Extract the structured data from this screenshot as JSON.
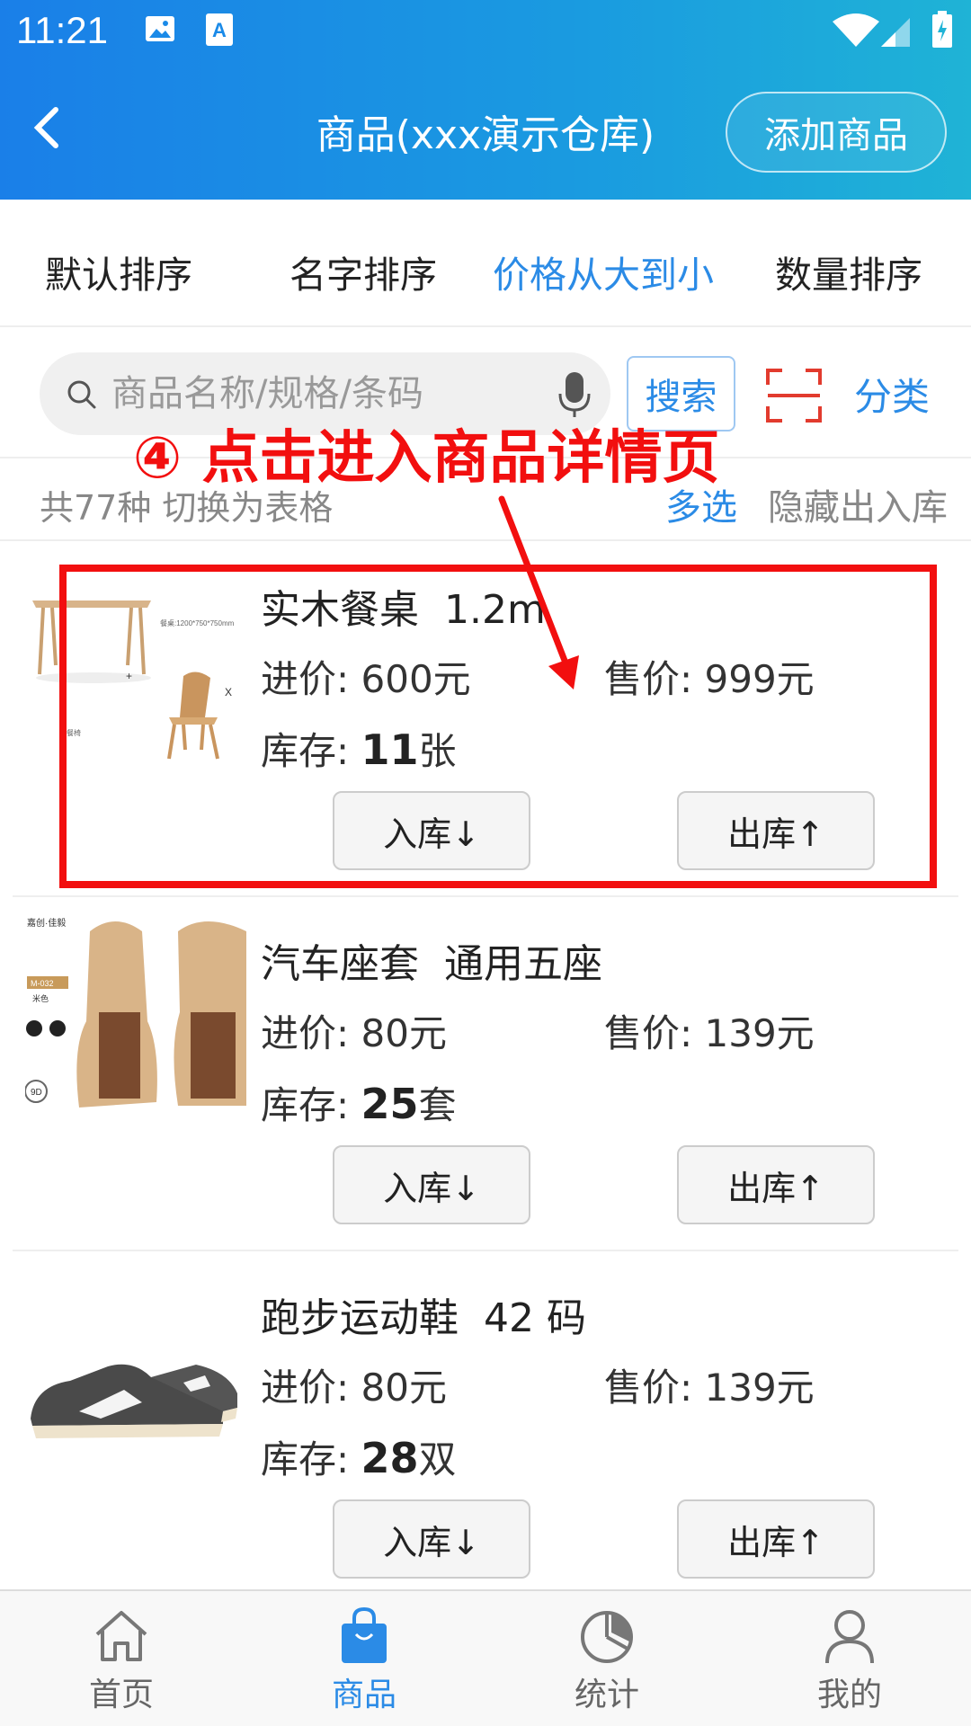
{
  "status": {
    "time": "11:21"
  },
  "header": {
    "title": "商品(xxx演示仓库)",
    "add_label": "添加商品"
  },
  "sort_tabs": [
    {
      "label": "默认排序"
    },
    {
      "label": "名字排序"
    },
    {
      "label": "价格从大到小",
      "active": true
    },
    {
      "label": "数量排序"
    }
  ],
  "search": {
    "placeholder": "商品名称/规格/条码",
    "button_label": "搜索",
    "category_label": "分类"
  },
  "info": {
    "count_text": "共77种  切换为表格",
    "multi_select": "多选",
    "hide_label": "隐藏出入库"
  },
  "annotation": {
    "text": "④ 点击进入商品详情页"
  },
  "products": [
    {
      "name": "实木餐桌  1.2m",
      "cost_label": "进价:",
      "cost": "600元",
      "price_label": "售价:",
      "price": "999元",
      "stock_label": "库存:",
      "stock": "11",
      "unit": "张",
      "in_label": "入库↓",
      "out_label": "出库↑"
    },
    {
      "name": "汽车座套  通用五座",
      "cost_label": "进价:",
      "cost": "80元",
      "price_label": "售价:",
      "price": "139元",
      "stock_label": "库存:",
      "stock": "25",
      "unit": "套",
      "in_label": "入库↓",
      "out_label": "出库↑"
    },
    {
      "name": "跑步运动鞋  42 码",
      "cost_label": "进价:",
      "cost": "80元",
      "price_label": "售价:",
      "price": "139元",
      "stock_label": "库存:",
      "stock": "28",
      "unit": "双",
      "in_label": "入库↓",
      "out_label": "出库↑"
    }
  ],
  "bottom_nav": [
    {
      "label": "首页",
      "icon": "home-icon"
    },
    {
      "label": "商品",
      "icon": "shopping-bag-icon",
      "active": true
    },
    {
      "label": "统计",
      "icon": "pie-chart-icon"
    },
    {
      "label": "我的",
      "icon": "user-icon"
    }
  ],
  "colors": {
    "accent": "#2b8be6",
    "annotation": "#f20f0f",
    "header_start": "#1a7fe8",
    "header_end": "#1fb3d6"
  }
}
